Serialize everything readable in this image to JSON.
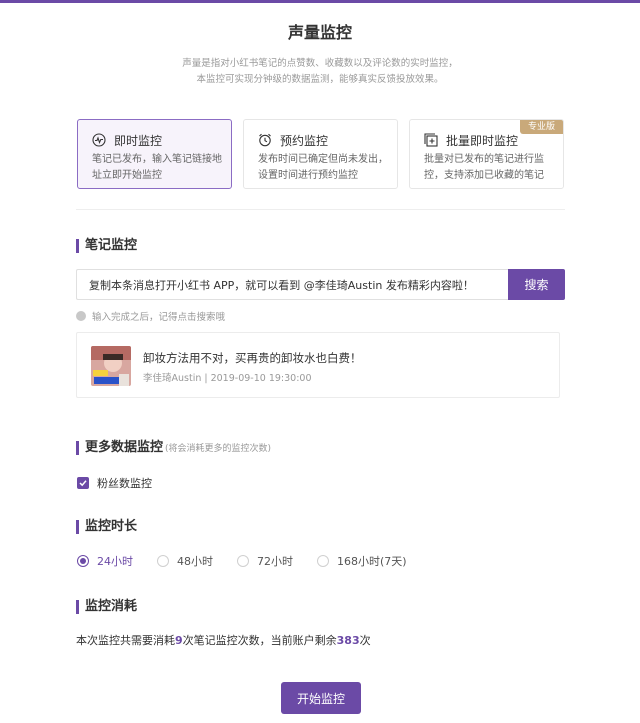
{
  "page": {
    "title": "声量监控",
    "description_line1": "声量是指对小红书笔记的点赞数、收藏数以及评论数的实时监控，",
    "description_line2": "本监控可实现分钟级的数据监测，能够真实反馈投放效果。"
  },
  "modes": [
    {
      "title": "即时监控",
      "line1": "笔记已发布，输入笔记链接地",
      "line2": "址立即开始监控",
      "icon": "pulse-icon",
      "active": true
    },
    {
      "title": "预约监控",
      "line1": "发布时间已确定但尚未发出，",
      "line2": "设置时间进行预约监控",
      "icon": "alarm-clock-icon",
      "active": false
    },
    {
      "title": "批量即时监控",
      "line1": "批量对已发布的笔记进行监",
      "line2": "控，支持添加已收藏的笔记",
      "icon": "batch-add-icon",
      "active": false,
      "badge": "专业版"
    }
  ],
  "note_monitor": {
    "section_title": "笔记监控",
    "input_value": "复制本条消息打开小红书 APP，就可以看到 @李佳琦Austin 发布精彩内容啦！",
    "search_label": "搜索",
    "hint": "输入完成之后，记得点击搜索哦",
    "note": {
      "title": "卸妆方法用不对，买再贵的卸妆水也白费！",
      "meta": "李佳琦Austin | 2019-09-10 19:30:00"
    }
  },
  "more_data": {
    "section_title": "更多数据监控",
    "section_note": "(将会消耗更多的监控次数)",
    "checkbox_label": "粉丝数监控",
    "checked": true
  },
  "duration": {
    "section_title": "监控时长",
    "options": [
      "24小时",
      "48小时",
      "72小时",
      "168小时(7天)"
    ],
    "selected": "24小时"
  },
  "cost": {
    "section_title": "监控消耗",
    "text_before": "本次监控共需要消耗",
    "required": "9",
    "text_middle": "次笔记监控次数，当前账户剩余",
    "remaining": "383",
    "text_after": "次"
  },
  "start_label": "开始监控",
  "colors": {
    "accent": "#6b4aa6",
    "badge": "#c9a97a"
  }
}
